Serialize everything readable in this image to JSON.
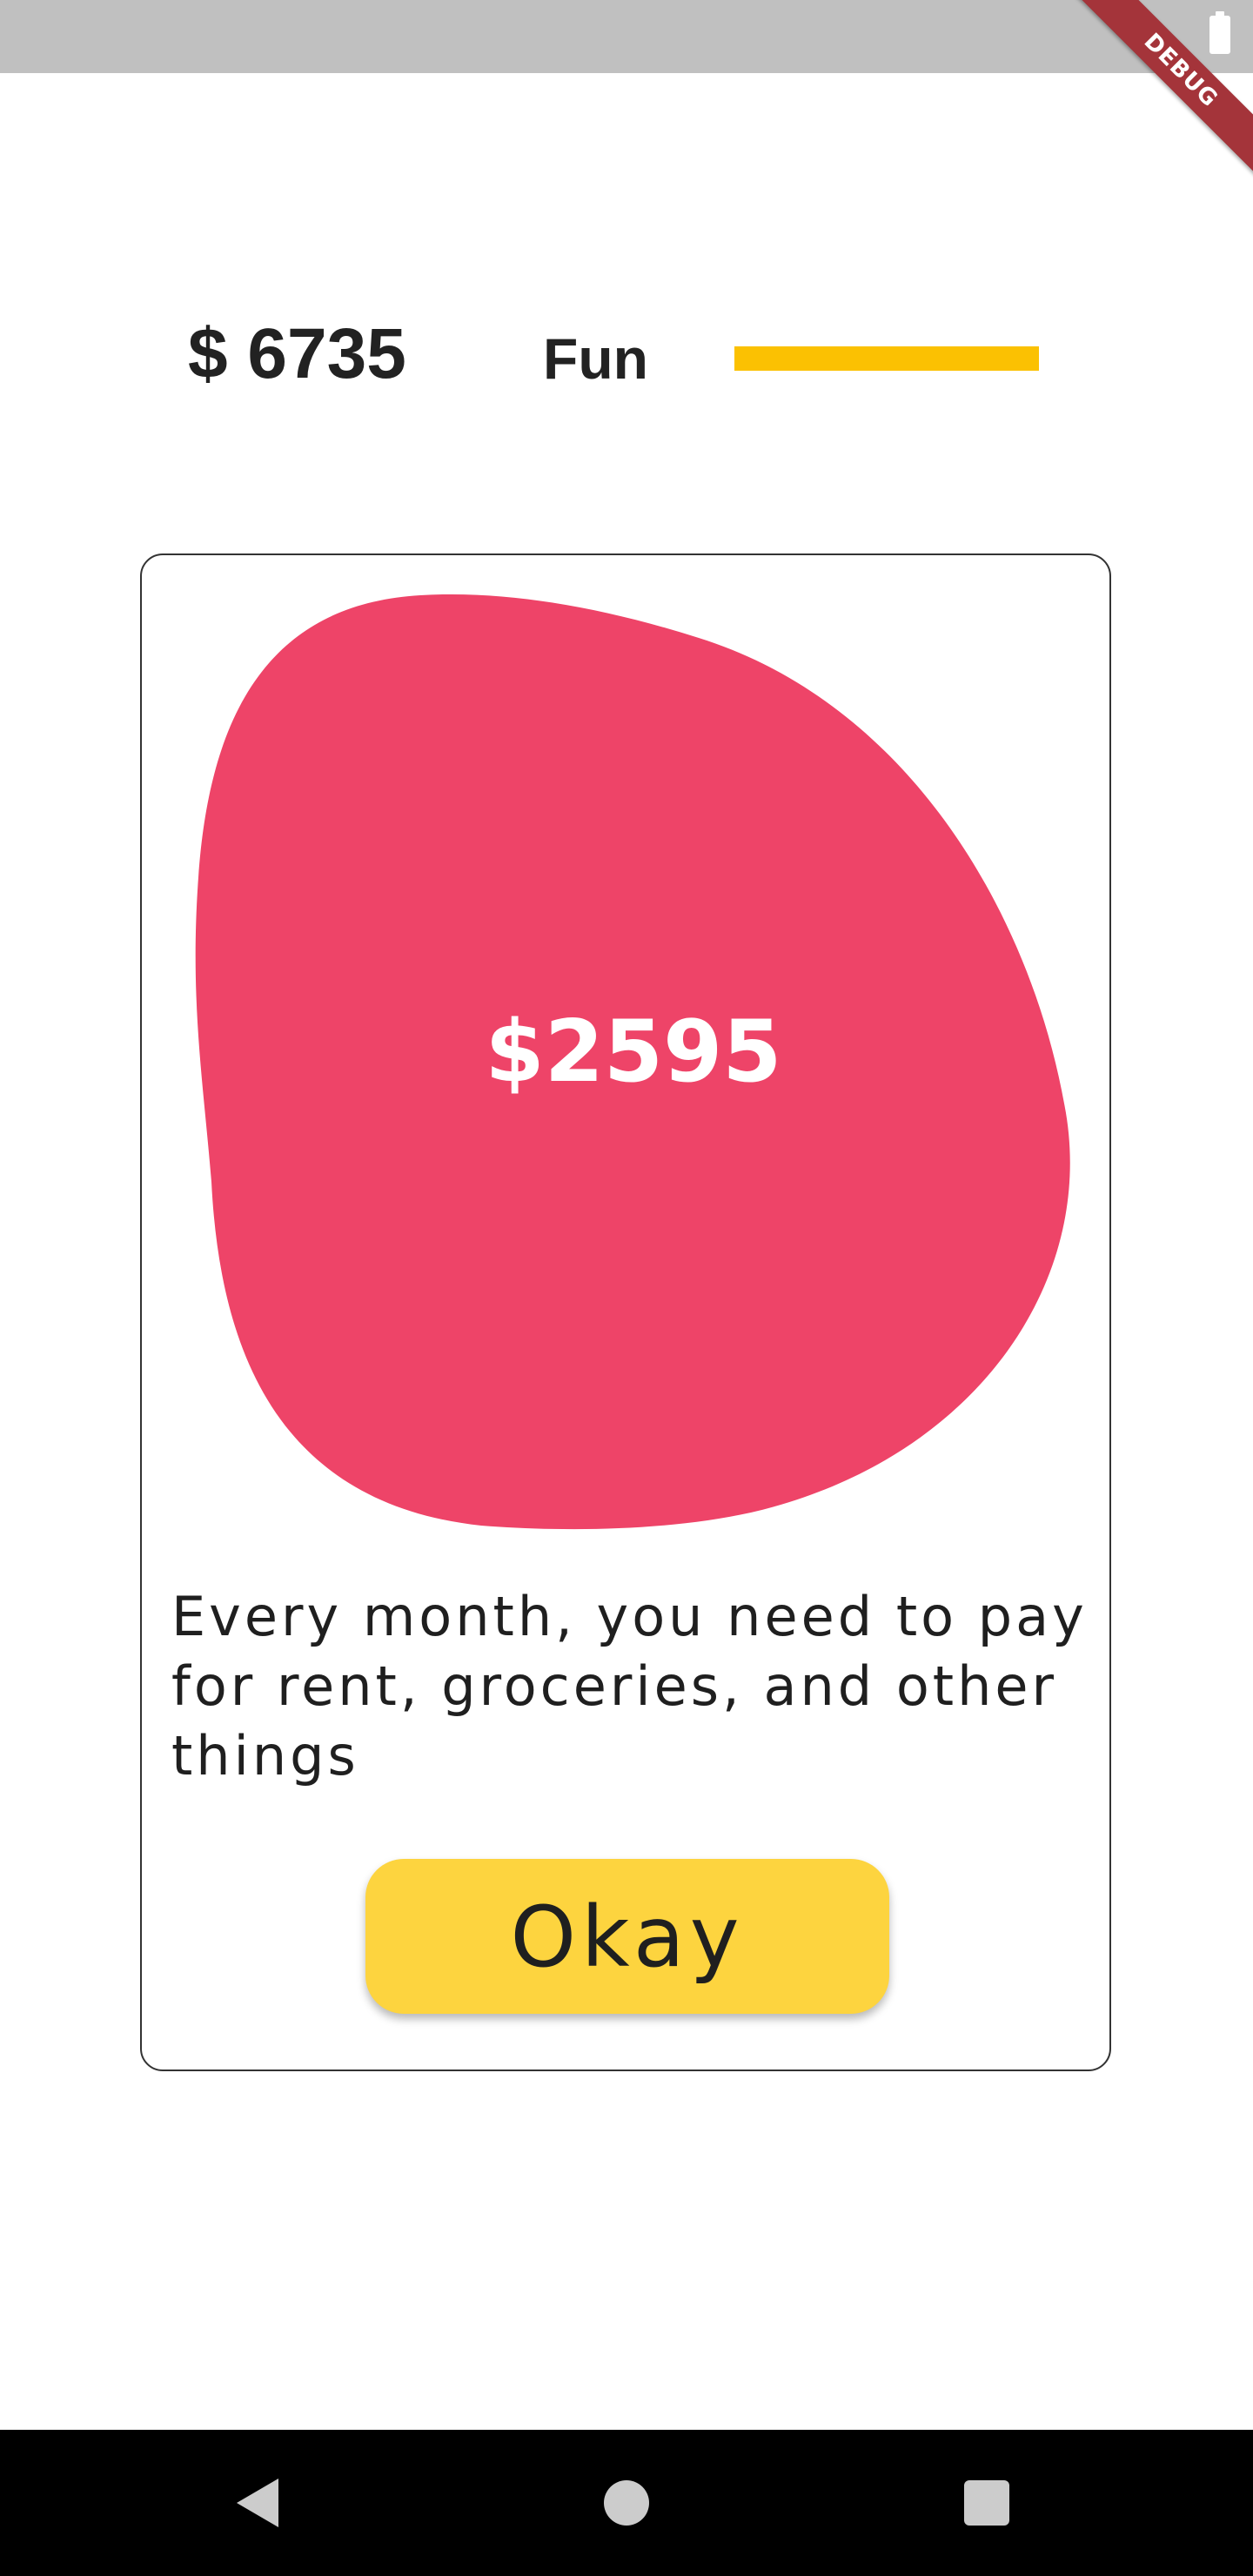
{
  "status_bar": {
    "debug_label": "DEBUG",
    "battery_icon": "battery-icon"
  },
  "header": {
    "balance": "$ 6735",
    "category": "Fun",
    "progress": 1.0,
    "progress_color": "#fbc102"
  },
  "card": {
    "amount": "$2595",
    "blob_color": "#ee4468",
    "message": "Every month, you need to pay for rent, groceries, and other things",
    "button_label": "Okay",
    "button_color": "#fdd43f"
  },
  "nav_bar": {
    "back_icon": "triangle-back-icon",
    "home_icon": "circle-home-icon",
    "recents_icon": "square-recents-icon"
  }
}
